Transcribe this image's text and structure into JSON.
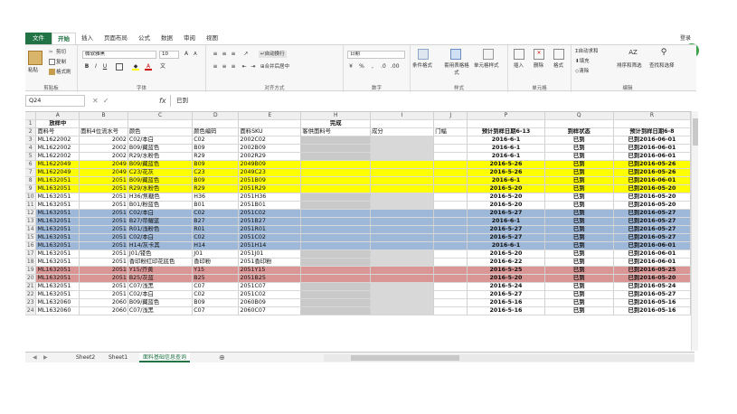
{
  "ribbon": {
    "tabs": [
      "文件",
      "开始",
      "插入",
      "页面布局",
      "公式",
      "数据",
      "审阅",
      "视图"
    ],
    "login": "登录",
    "clipboard": {
      "paste": "粘贴",
      "cut": "剪切",
      "copy": "复制",
      "format_painter": "格式刷",
      "label": "剪贴板"
    },
    "font": {
      "name": "微软雅黑",
      "size": "10",
      "label": "字体"
    },
    "alignment": {
      "wrap": "自动换行",
      "merge": "合并后居中",
      "label": "对齐方式"
    },
    "number": {
      "format": "日期",
      "label": "数字"
    },
    "styles": {
      "conditional": "条件格式",
      "table": "套用表格格式",
      "cell": "单元格样式",
      "label": "样式"
    },
    "cells": {
      "insert": "插入",
      "delete": "删除",
      "format": "格式",
      "label": "单元格"
    },
    "editing": {
      "autosum": "自动求和",
      "fill": "填充",
      "clear": "清除",
      "sort": "排序和筛选",
      "find": "查找和选择",
      "label": "编辑"
    }
  },
  "formula": {
    "name_box": "Q24",
    "value": "已到"
  },
  "columns": [
    "A",
    "B",
    "C",
    "D",
    "E",
    "H",
    "I",
    "J",
    "P",
    "Q",
    "R"
  ],
  "row1": {
    "a": "放样中",
    "h": "完成"
  },
  "headers": {
    "a": "面料号",
    "b": "面料4位流水号",
    "c": "颜色",
    "d": "颜色编码",
    "e": "面料SKU",
    "h": "客供面料号",
    "i": "成分",
    "j": "门幅",
    "p": "预计到样日期6-13",
    "q": "到样状态",
    "r": "预计到样日期6-8"
  },
  "rows": [
    {
      "n": "3",
      "a": "ML1622002",
      "b": "2002",
      "c": "C02/本白",
      "d": "C02",
      "e": "2002C02",
      "p": "2016-6-1",
      "q": "已到",
      "r": "已到2016-06-01",
      "cls": ""
    },
    {
      "n": "4",
      "a": "ML1622002",
      "b": "2002",
      "c": "B09/藏蓝色",
      "d": "B09",
      "e": "2002B09",
      "p": "2016-6-1",
      "q": "已到",
      "r": "已到2016-06-01",
      "cls": ""
    },
    {
      "n": "5",
      "a": "ML1622002",
      "b": "2002",
      "c": "R29/水粉色",
      "d": "R29",
      "e": "2002R29",
      "p": "2016-6-1",
      "q": "已到",
      "r": "已到2016-06-01",
      "cls": ""
    },
    {
      "n": "6",
      "a": "ML1622049",
      "b": "2049",
      "c": "B09/藏蓝色",
      "d": "B09",
      "e": "2049B09",
      "p": "2016-5-26",
      "q": "已到",
      "r": "已到2016-05-26",
      "cls": "y"
    },
    {
      "n": "7",
      "a": "ML1622049",
      "b": "2049",
      "c": "C23/花灰",
      "d": "C23",
      "e": "2049C23",
      "p": "2016-5-26",
      "q": "已到",
      "r": "已到2016-05-26",
      "cls": "y"
    },
    {
      "n": "8",
      "a": "ML1632051",
      "b": "2051",
      "c": "B09/藏蓝色",
      "d": "B09",
      "e": "2051B09",
      "p": "2016-6-1",
      "q": "已到",
      "r": "已到2016-06-01",
      "cls": "y"
    },
    {
      "n": "9",
      "a": "ML1632051",
      "b": "2051",
      "c": "R29/水粉色",
      "d": "R29",
      "e": "2051R29",
      "p": "2016-5-20",
      "q": "已到",
      "r": "已到2016-05-20",
      "cls": "y"
    },
    {
      "n": "10",
      "a": "ML1632051",
      "b": "2051",
      "c": "H36/焦糖色",
      "d": "H36",
      "e": "2051H36",
      "p": "2016-5-20",
      "q": "已到",
      "r": "已到2016-05-20",
      "cls": ""
    },
    {
      "n": "11",
      "a": "ML1632051",
      "b": "2051",
      "c": "B01/粉蓝色",
      "d": "B01",
      "e": "2051B01",
      "p": "2016-5-20",
      "q": "已到",
      "r": "已到2016-05-20",
      "cls": ""
    },
    {
      "n": "12",
      "a": "ML1632051",
      "b": "2051",
      "c": "C02/本白",
      "d": "C02",
      "e": "2051C02",
      "p": "2016-5-27",
      "q": "已到",
      "r": "已到2016-05-27",
      "cls": "b"
    },
    {
      "n": "13",
      "a": "ML1632051",
      "b": "2051",
      "c": "B27/帝耀蓝",
      "d": "B27",
      "e": "2051B27",
      "p": "2016-6-1",
      "q": "已到",
      "r": "已到2016-05-27",
      "cls": "b"
    },
    {
      "n": "14",
      "a": "ML1632051",
      "b": "2051",
      "c": "R01/浅粉色",
      "d": "R01",
      "e": "2051R01",
      "p": "2016-5-27",
      "q": "已到",
      "r": "已到2016-05-27",
      "cls": "b"
    },
    {
      "n": "15",
      "a": "ML1632051",
      "b": "2051",
      "c": "C02/本白",
      "d": "C02",
      "e": "2051C02",
      "p": "2016-5-27",
      "q": "已到",
      "r": "已到2016-05-27",
      "cls": "b"
    },
    {
      "n": "16",
      "a": "ML1632051",
      "b": "2051",
      "c": "H14/灰卡其",
      "d": "H14",
      "e": "2051H14",
      "p": "2016-6-1",
      "q": "已到",
      "r": "已到2016-06-01",
      "cls": "b"
    },
    {
      "n": "17",
      "a": "ML1632051",
      "b": "2051",
      "c": "J01/镂色",
      "d": "J01",
      "e": "2051J01",
      "p": "2016-5-20",
      "q": "已到",
      "r": "已到2016-06-01",
      "cls": ""
    },
    {
      "n": "18",
      "a": "ML1632051",
      "b": "2051",
      "c": "香印粉红印花底色",
      "d": "香印粉",
      "e": "2051香印粉",
      "p": "2016-6-22",
      "q": "已到",
      "r": "已到2016-06-01",
      "cls": ""
    },
    {
      "n": "19",
      "a": "ML1632051",
      "b": "2051",
      "c": "Y15/芥黄",
      "d": "Y15",
      "e": "2051Y15",
      "p": "2016-5-25",
      "q": "已到",
      "r": "已到2016-05-25",
      "cls": "r"
    },
    {
      "n": "20",
      "a": "ML1632051",
      "b": "2051",
      "c": "B25/灰蓝",
      "d": "B25",
      "e": "2051B25",
      "p": "2016-5-20",
      "q": "已到",
      "r": "已到2016-05-20",
      "cls": "r"
    },
    {
      "n": "21",
      "a": "ML1632051",
      "b": "2051",
      "c": "C07/浅黑",
      "d": "C07",
      "e": "2051C07",
      "p": "2016-5-24",
      "q": "已到",
      "r": "已到2016-05-24",
      "cls": ""
    },
    {
      "n": "22",
      "a": "ML1632051",
      "b": "2051",
      "c": "C02/本白",
      "d": "C02",
      "e": "2051C02",
      "p": "2016-5-27",
      "q": "已到",
      "r": "已到2016-05-27",
      "cls": ""
    },
    {
      "n": "23",
      "a": "ML1632060",
      "b": "2060",
      "c": "B09/藏蓝色",
      "d": "B09",
      "e": "2060B09",
      "p": "2016-5-16",
      "q": "已到",
      "r": "已到2016-05-16",
      "cls": ""
    },
    {
      "n": "24",
      "a": "ML1632060",
      "b": "2060",
      "c": "C07/浅黑",
      "d": "C07",
      "e": "2060C07",
      "p": "2016-5-16",
      "q": "已到",
      "r": "已到2016-05-16",
      "cls": ""
    }
  ],
  "sheets": [
    "Sheet2",
    "Sheet1",
    "面料基础信息查询"
  ]
}
